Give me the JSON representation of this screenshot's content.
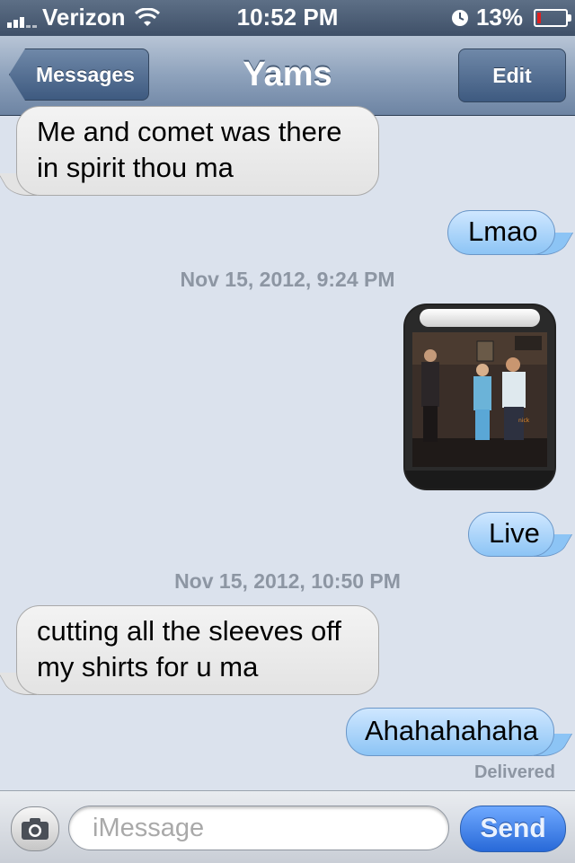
{
  "status_bar": {
    "carrier": "Verizon",
    "time": "10:52 PM",
    "battery_percent": "13%",
    "battery_level": 0.13,
    "icons": [
      "signal-bars",
      "wifi-icon",
      "clock-icon",
      "battery-icon"
    ]
  },
  "nav": {
    "back_label": "Messages",
    "title": "Yams",
    "edit_label": "Edit"
  },
  "messages": [
    {
      "direction": "incoming",
      "text_line1": "Me and comet was there",
      "text_line2": "in spirit thou ma"
    },
    {
      "direction": "outgoing",
      "text": "Lmao"
    },
    {
      "type": "timestamp",
      "text": "Nov 15, 2012, 9:24 PM"
    },
    {
      "direction": "outgoing",
      "type": "photo"
    },
    {
      "direction": "outgoing",
      "text": "Live"
    },
    {
      "type": "timestamp",
      "text": "Nov 15, 2012, 10:50 PM"
    },
    {
      "direction": "incoming",
      "text_line1": "cutting all the sleeves off",
      "text_line2": "my shirts for u ma"
    },
    {
      "direction": "outgoing",
      "text": "Ahahahahaha"
    }
  ],
  "delivered_label": "Delivered",
  "input": {
    "placeholder": "iMessage",
    "send_label": "Send"
  },
  "colors": {
    "background": "#dbe2ed",
    "incoming_bubble": "#e3e3e3",
    "outgoing_bubble": "#8cc4f5",
    "send_button": "#2869d8",
    "timestamp": "#8d96a3"
  }
}
